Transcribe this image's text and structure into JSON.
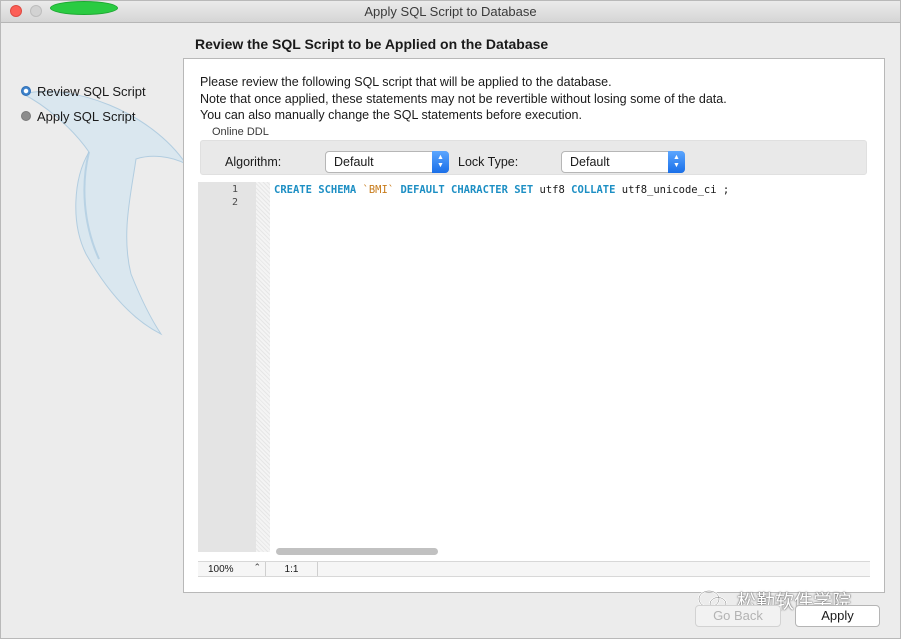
{
  "window": {
    "title": "Apply SQL Script to Database"
  },
  "sidebar": {
    "steps": [
      {
        "label": "Review SQL Script",
        "state": "current"
      },
      {
        "label": "Apply SQL Script",
        "state": "pending"
      }
    ]
  },
  "page": {
    "heading": "Review the SQL Script to be Applied on the Database"
  },
  "description": {
    "line1": "Please review the following SQL script that will be applied to the database.",
    "line2": "Note that once applied, these statements may not be revertible without losing some of the data.",
    "line3": "You can also manually change the SQL statements before execution."
  },
  "online_ddl": {
    "label": "Online DDL",
    "algorithm_label": "Algorithm:",
    "algorithm_value": "Default",
    "lock_label": "Lock Type:",
    "lock_value": "Default"
  },
  "editor": {
    "line_numbers": [
      "1",
      "2"
    ],
    "tokens": [
      {
        "text": "CREATE SCHEMA ",
        "type": "keyword"
      },
      {
        "text": "`BMI`",
        "type": "string"
      },
      {
        "text": " ",
        "type": "plain"
      },
      {
        "text": "DEFAULT CHARACTER SET",
        "type": "keyword"
      },
      {
        "text": " utf8 ",
        "type": "plain"
      },
      {
        "text": "COLLATE",
        "type": "keyword"
      },
      {
        "text": " utf8_unicode_ci ;",
        "type": "plain"
      }
    ],
    "zoom": "100%",
    "cursor_position": "1:1",
    "horizontal_scroll_fraction": 0.28
  },
  "footer": {
    "watermark": "松勤软件学院",
    "back_label": "Go Back",
    "apply_label": "Apply"
  },
  "colors": {
    "keyword": "#1d8fc4",
    "string": "#c87b1a",
    "accent": "#1a6fe8"
  }
}
